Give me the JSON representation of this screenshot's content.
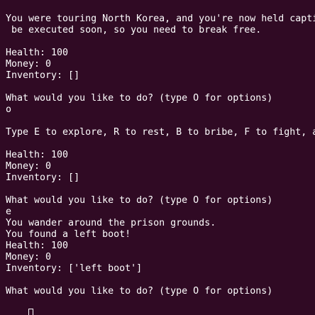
{
  "terminal": {
    "lines": [
      "You were touring North Korea, and you're now held capti",
      " be executed soon, so you need to break free.",
      "",
      "Health: 100",
      "Money: 0",
      "Inventory: []",
      "",
      "What would you like to do? (type O for options)",
      "o",
      "",
      "Type E to explore, R to rest, B to bribe, F to fight, a",
      "",
      "Health: 100",
      "Money: 0",
      "Inventory: []",
      "",
      "What would you like to do? (type O for options)",
      "e",
      "You wander around the prison grounds.",
      "You found a left boot!",
      "Health: 100",
      "Money: 0",
      "Inventory: ['left boot']",
      "",
      "What would you like to do? (type O for options)"
    ],
    "colors": {
      "background": "#300a24",
      "foreground": "#ffffff"
    }
  }
}
